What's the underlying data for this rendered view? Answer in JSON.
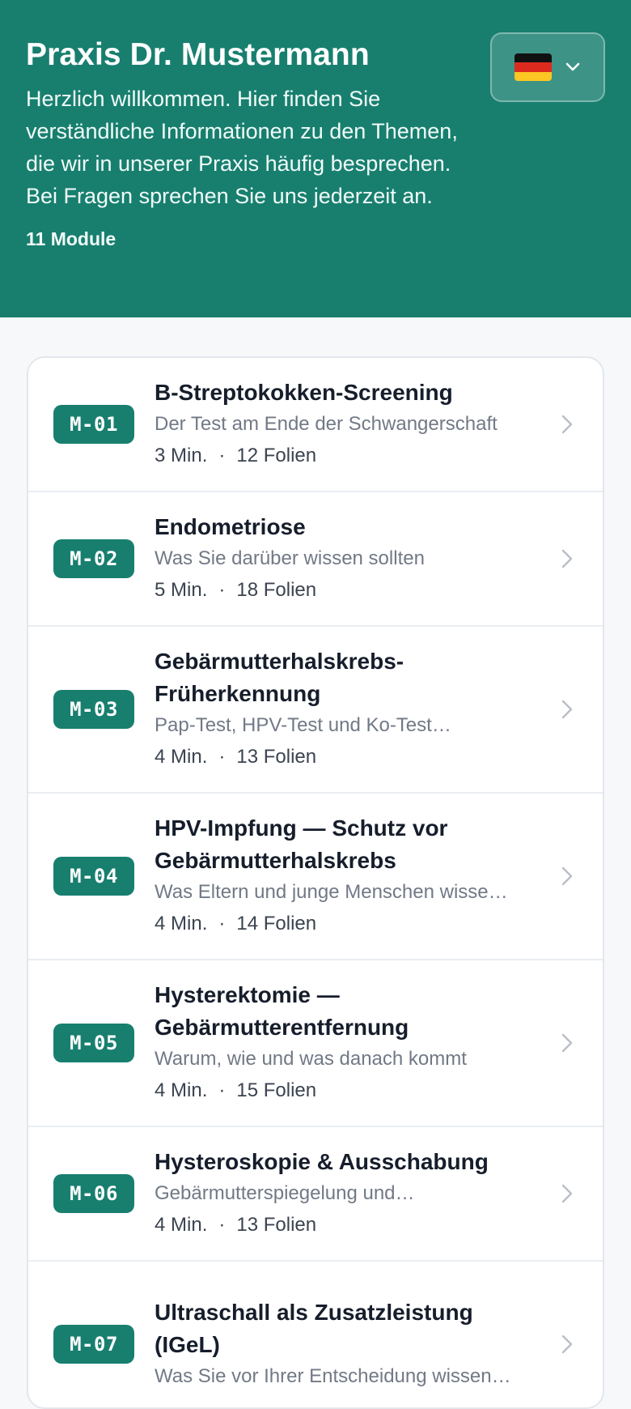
{
  "header": {
    "title": "Praxis Dr. Mustermann",
    "intro": "Herzlich willkommen. Hier finden Sie verständliche Informationen zu den Themen, die wir in unserer Praxis häufig besprechen. Bei Fragen sprechen Sie uns jederzeit an.",
    "module_count": "11 Module",
    "language": {
      "flag": "german-flag-icon",
      "icon": "chevron-down-icon"
    }
  },
  "colors": {
    "brand": "#187f6f",
    "background": "#f6f8fa",
    "badge_text": "#ffffff"
  },
  "modules": [
    {
      "code": "M-01",
      "title": "B-Streptokokken-Screening",
      "subtitle": "Der Test am Ende der Schwangerschaft",
      "duration": "3 Min.",
      "separator": "·",
      "slides": "12 Folien"
    },
    {
      "code": "M-02",
      "title": "Endometriose",
      "subtitle": "Was Sie darüber wissen sollten",
      "duration": "5 Min.",
      "separator": "·",
      "slides": "18 Folien"
    },
    {
      "code": "M-03",
      "title": "Gebärmutterhalskrebs-Früherkennung",
      "subtitle": "Pap-Test, HPV-Test und Ko-Test…",
      "duration": "4 Min.",
      "separator": "·",
      "slides": "13 Folien"
    },
    {
      "code": "M-04",
      "title": "HPV-Impfung — Schutz vor Gebärmutterhalskrebs",
      "subtitle": "Was Eltern und junge Menschen wisse…",
      "duration": "4 Min.",
      "separator": "·",
      "slides": "14 Folien"
    },
    {
      "code": "M-05",
      "title": "Hysterektomie — Gebärmutterentfernung",
      "subtitle": "Warum, wie und was danach kommt",
      "duration": "4 Min.",
      "separator": "·",
      "slides": "15 Folien"
    },
    {
      "code": "M-06",
      "title": "Hysteroskopie & Ausschabung",
      "subtitle": "Gebärmutterspiegelung und…",
      "duration": "4 Min.",
      "separator": "·",
      "slides": "13 Folien"
    },
    {
      "code": "M-07",
      "title": "Ultraschall als Zusatzleistung (IGeL)",
      "subtitle": "Was Sie vor Ihrer Entscheidung wissen…",
      "duration": "",
      "separator": "",
      "slides": ""
    }
  ]
}
